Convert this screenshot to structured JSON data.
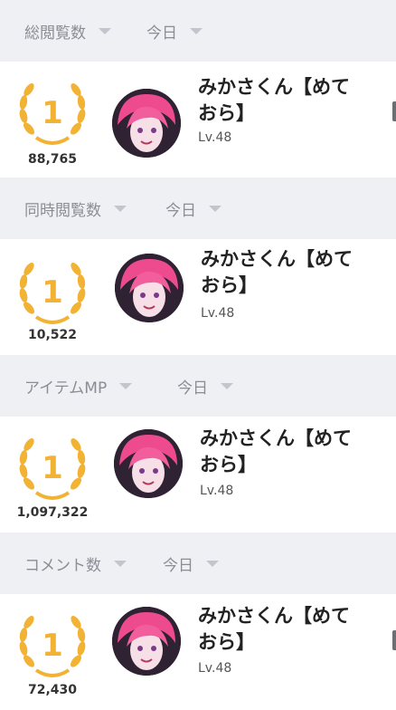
{
  "sections": [
    {
      "metric": "総閲覧数",
      "period": "今日",
      "rank": "1",
      "name": "みかさくん【めておら】",
      "level": "Lv.48",
      "count": "88,765"
    },
    {
      "metric": "同時閲覧数",
      "period": "今日",
      "rank": "1",
      "name": "みかさくん【めておら】",
      "level": "Lv.48",
      "count": "10,522"
    },
    {
      "metric": "アイテムMP",
      "period": "今日",
      "rank": "1",
      "name": "みかさくん【めておら】",
      "level": "Lv.48",
      "count": "1,097,322"
    },
    {
      "metric": "コメント数",
      "period": "今日",
      "rank": "1",
      "name": "みかさくん【めておら】",
      "level": "Lv.48",
      "count": "72,430"
    }
  ],
  "colors": {
    "medal": "#f2b233",
    "header_bg": "#eef0f4",
    "avatar_hair": "#ee4b8f"
  }
}
